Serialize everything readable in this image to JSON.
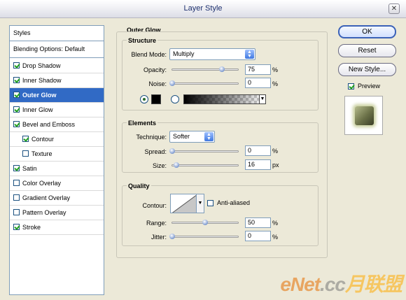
{
  "window": {
    "title": "Layer Style",
    "close_glyph": "✕"
  },
  "sidebar": {
    "header": "Styles",
    "items": [
      {
        "label": "Blending Options: Default",
        "checkbox": null,
        "selected": false
      },
      {
        "label": "Drop Shadow",
        "checkbox": true,
        "selected": false
      },
      {
        "label": "Inner Shadow",
        "checkbox": true,
        "selected": false
      },
      {
        "label": "Outer Glow",
        "checkbox": true,
        "selected": true
      },
      {
        "label": "Inner Glow",
        "checkbox": true,
        "selected": false
      },
      {
        "label": "Bevel and Emboss",
        "checkbox": true,
        "selected": false
      },
      {
        "label": "Contour",
        "checkbox": true,
        "selected": false
      },
      {
        "label": "Texture",
        "checkbox": false,
        "selected": false
      },
      {
        "label": "Satin",
        "checkbox": true,
        "selected": false
      },
      {
        "label": "Color Overlay",
        "checkbox": false,
        "selected": false
      },
      {
        "label": "Gradient Overlay",
        "checkbox": false,
        "selected": false
      },
      {
        "label": "Pattern Overlay",
        "checkbox": false,
        "selected": false
      },
      {
        "label": "Stroke",
        "checkbox": true,
        "selected": false
      }
    ]
  },
  "panel": {
    "title": "Outer Glow",
    "structure": {
      "title": "Structure",
      "blend_mode_label": "Blend Mode:",
      "blend_mode_value": "Multiply",
      "opacity_label": "Opacity:",
      "opacity_value": "75",
      "opacity_fraction": 0.75,
      "opacity_unit": "%",
      "noise_label": "Noise:",
      "noise_value": "0",
      "noise_fraction": 0,
      "noise_unit": "%",
      "glow_color": "#000000"
    },
    "elements": {
      "title": "Elements",
      "technique_label": "Technique:",
      "technique_value": "Softer",
      "spread_label": "Spread:",
      "spread_value": "0",
      "spread_fraction": 0,
      "spread_unit": "%",
      "size_label": "Size:",
      "size_value": "16",
      "size_fraction": 0.065,
      "size_unit": "px"
    },
    "quality": {
      "title": "Quality",
      "contour_label": "Contour:",
      "anti_aliased_label": "Anti-aliased",
      "anti_aliased": false,
      "range_label": "Range:",
      "range_value": "50",
      "range_fraction": 0.5,
      "range_unit": "%",
      "jitter_label": "Jitter:",
      "jitter_value": "0",
      "jitter_fraction": 0,
      "jitter_unit": "%"
    }
  },
  "buttons": {
    "ok": "OK",
    "reset": "Reset",
    "new_style": "New Style...",
    "preview_label": "Preview",
    "preview_checked": true
  },
  "watermark": {
    "text_a": "eNet",
    "text_b": ".cc",
    "text_c": "月联盟"
  },
  "colors": {
    "accent": "#316ac5",
    "title_text": "#1c2f6e"
  }
}
